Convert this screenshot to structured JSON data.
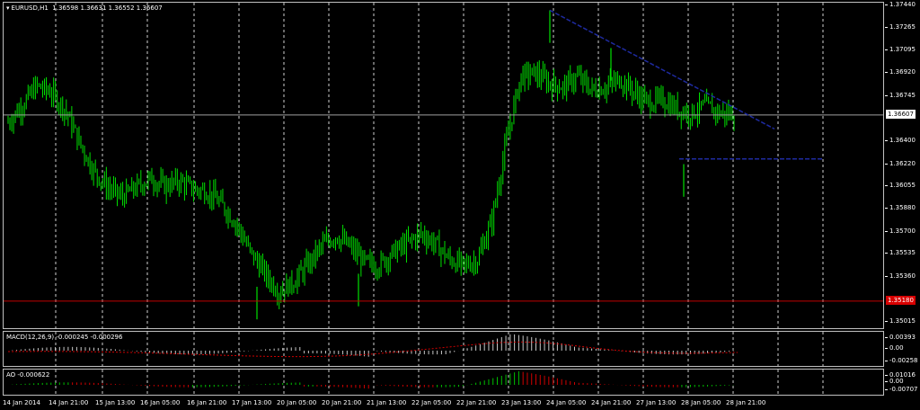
{
  "main": {
    "symbol_label": "EURUSD,H1",
    "ohlc_label": "1.36598 1.36631 1.36552 1.36607",
    "price_ticks": [
      "1.37440",
      "1.37265",
      "1.37095",
      "1.36920",
      "1.36745",
      "1.36400",
      "1.36220",
      "1.36055",
      "1.35880",
      "1.35700",
      "1.35535",
      "1.35360",
      "1.35015"
    ],
    "current_price": "1.36607",
    "support_price": "1.35180",
    "colors": {
      "candles": "#00e000",
      "trendline": "#1e2aa0",
      "support": "#c00000",
      "grid": "#c8c8c8",
      "current": "#a0a0a0"
    }
  },
  "macd": {
    "label": "MACD(12,26,9) -0.000245 -0.000296",
    "ticks": [
      "0.00393",
      "0.00",
      "-0.00258"
    ]
  },
  "ao": {
    "label": "AO -0.000622",
    "ticks": [
      "0.01016",
      "0.00",
      "-0.00707"
    ]
  },
  "time_axis": {
    "labels": [
      "14 Jan 2014",
      "14 Jan 21:00",
      "15 Jan 13:00",
      "16 Jan 05:00",
      "16 Jan 21:00",
      "17 Jan 13:00",
      "20 Jan 05:00",
      "20 Jan 21:00",
      "21 Jan 13:00",
      "22 Jan 05:00",
      "22 Jan 21:00",
      "23 Jan 13:00",
      "24 Jan 05:00",
      "24 Jan 21:00",
      "27 Jan 13:00",
      "28 Jan 05:00",
      "28 Jan 21:00"
    ]
  },
  "chart_data": {
    "type": "candlestick",
    "x_start": "14 Jan 2014",
    "timeframe": "H1",
    "close_series": [
      1.3655,
      1.3668,
      1.3683,
      1.3678,
      1.3665,
      1.364,
      1.3618,
      1.3605,
      1.3598,
      1.3605,
      1.3612,
      1.3606,
      1.361,
      1.3604,
      1.3602,
      1.3592,
      1.3578,
      1.3556,
      1.354,
      1.3525,
      1.3532,
      1.3545,
      1.356,
      1.3568,
      1.356,
      1.3548,
      1.3545,
      1.3555,
      1.3562,
      1.357,
      1.3562,
      1.355,
      1.3545,
      1.355,
      1.358,
      1.364,
      1.369,
      1.3693,
      1.3685,
      1.3682,
      1.369,
      1.368,
      1.3682,
      1.3688,
      1.3678,
      1.367,
      1.3672,
      1.3665,
      1.3662,
      1.3668,
      1.3662,
      1.3661
    ]
  }
}
